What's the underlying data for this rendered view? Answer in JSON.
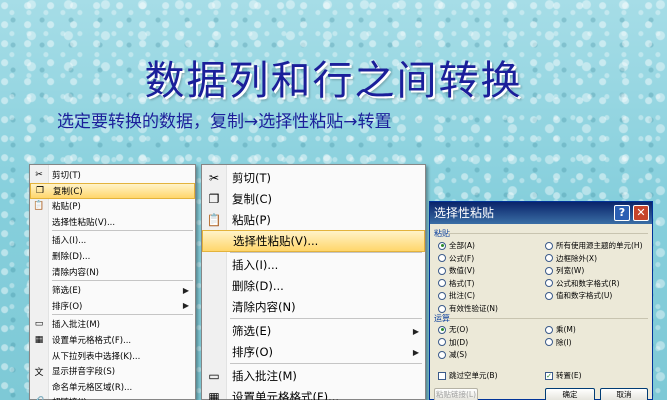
{
  "slide": {
    "title": "数据列和行之间转换",
    "subtitle": "选定要转换的数据，复制→选择性粘贴→转置"
  },
  "menu_small": {
    "items": [
      {
        "label": "剪切(T)",
        "icon": "scissors-icon",
        "glyph": "✂"
      },
      {
        "label": "复制(C)",
        "icon": "copy-icon",
        "glyph": "❐",
        "highlighted": true
      },
      {
        "label": "粘贴(P)",
        "icon": "paste-icon",
        "glyph": "📋"
      },
      {
        "label": "选择性粘贴(V)..."
      },
      {
        "label": "插入(I)..."
      },
      {
        "label": "删除(D)..."
      },
      {
        "label": "清除内容(N)"
      },
      {
        "label": "筛选(E)",
        "submenu": true
      },
      {
        "label": "排序(O)",
        "submenu": true
      },
      {
        "label": "插入批注(M)",
        "icon": "comment-icon",
        "glyph": "▭"
      },
      {
        "label": "设置单元格格式(F)...",
        "icon": "format-cells-icon",
        "glyph": "▦"
      },
      {
        "label": "从下拉列表中选择(K)..."
      },
      {
        "label": "显示拼音字段(S)",
        "icon": "phonetic-icon",
        "glyph": "文"
      },
      {
        "label": "命名单元格区域(R)..."
      },
      {
        "label": "超链接(I)...",
        "icon": "hyperlink-icon",
        "glyph": "🔗"
      }
    ]
  },
  "menu_large": {
    "items": [
      {
        "label": "剪切(T)",
        "icon": "scissors-icon",
        "glyph": "✂"
      },
      {
        "label": "复制(C)",
        "icon": "copy-icon",
        "glyph": "❐"
      },
      {
        "label": "粘贴(P)",
        "icon": "paste-icon",
        "glyph": "📋"
      },
      {
        "label": "选择性粘贴(V)...",
        "highlighted": true
      },
      {
        "label": "插入(I)..."
      },
      {
        "label": "删除(D)..."
      },
      {
        "label": "清除内容(N)"
      },
      {
        "label": "筛选(E)",
        "submenu": true
      },
      {
        "label": "排序(O)",
        "submenu": true
      },
      {
        "label": "插入批注(M)",
        "icon": "comment-icon",
        "glyph": "▭"
      },
      {
        "label": "设置单元格格式(F)...",
        "icon": "format-cells-icon",
        "glyph": "▦"
      }
    ]
  },
  "dialog": {
    "title": "选择性粘贴",
    "help": "?",
    "close": "✕",
    "paste_group": "粘贴",
    "paste_left": [
      {
        "label": "全部(A)",
        "selected": true
      },
      {
        "label": "公式(F)"
      },
      {
        "label": "数值(V)"
      },
      {
        "label": "格式(T)"
      },
      {
        "label": "批注(C)"
      },
      {
        "label": "有效性验证(N)"
      }
    ],
    "paste_right": [
      {
        "label": "所有使用源主题的单元(H)"
      },
      {
        "label": "边框除外(X)"
      },
      {
        "label": "列宽(W)"
      },
      {
        "label": "公式和数字格式(R)"
      },
      {
        "label": "值和数字格式(U)"
      }
    ],
    "op_group": "运算",
    "op_left": [
      {
        "label": "无(O)",
        "selected": true
      },
      {
        "label": "加(D)"
      },
      {
        "label": "减(S)"
      }
    ],
    "op_right": [
      {
        "label": "乘(M)"
      },
      {
        "label": "除(I)"
      }
    ],
    "skip_blanks": "跳过空单元(B)",
    "transpose": "转置(E)",
    "transpose_checked": true,
    "paste_link": "粘贴链接(L)",
    "ok": "确定",
    "cancel": "取消"
  }
}
